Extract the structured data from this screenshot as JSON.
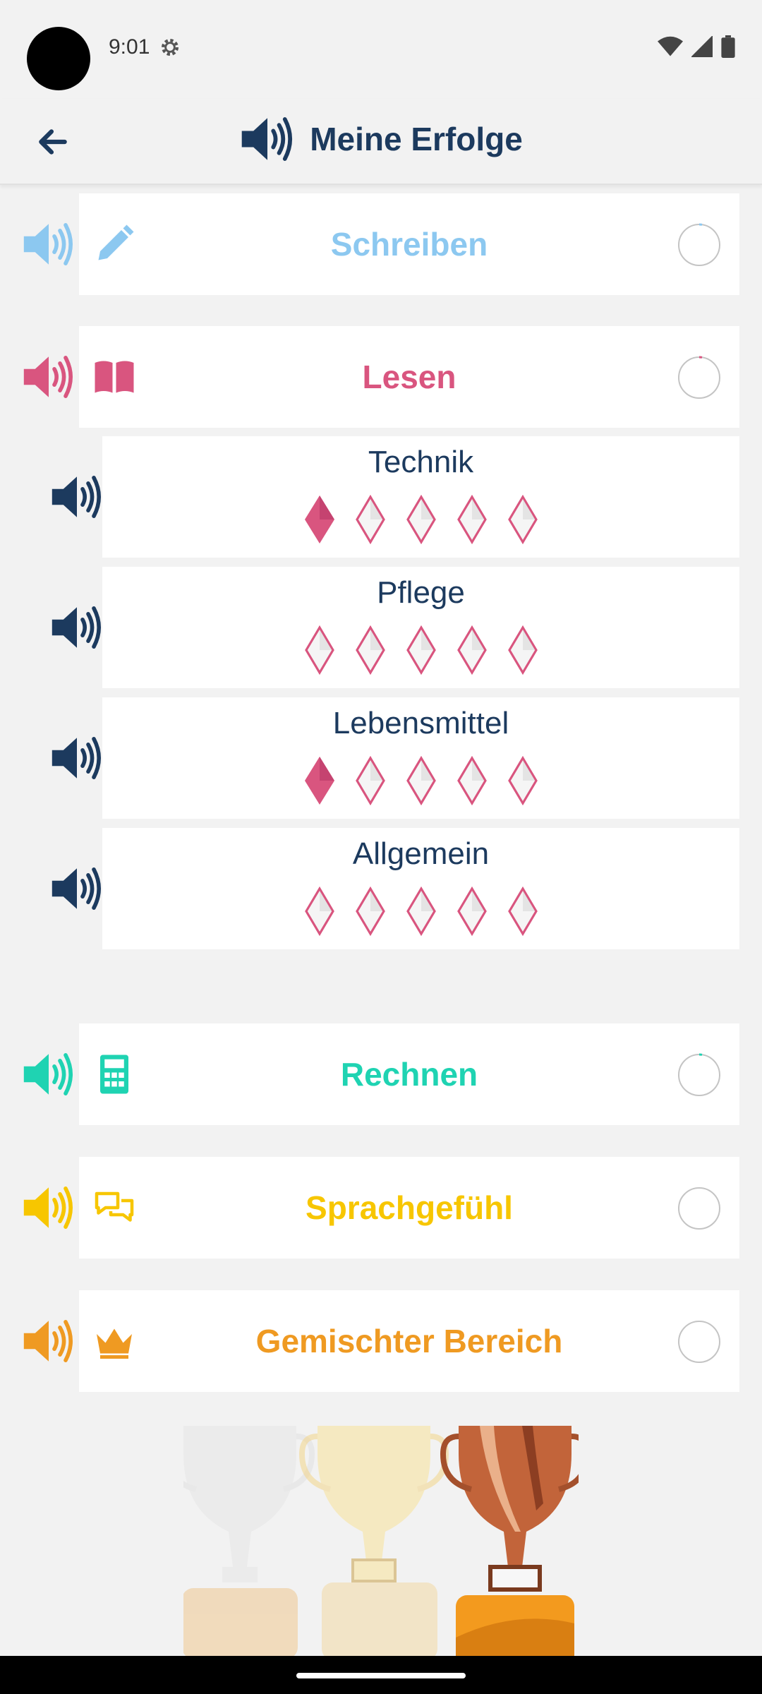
{
  "status": {
    "time": "9:01"
  },
  "header": {
    "title": "Meine Erfolge"
  },
  "colors": {
    "navy": "#1c3a5e",
    "schreiben": "#8cc8f0",
    "lesen": "#d9557f",
    "rechnen": "#1fd3b2",
    "sprachgefuehl": "#f7c600",
    "gemischt": "#ef9a22"
  },
  "categories": [
    {
      "label": "Schreiben",
      "icon": "pencil-icon",
      "color": "#8cc8f0",
      "progress": 0.02
    },
    {
      "label": "Lesen",
      "icon": "book-icon",
      "color": "#d9557f",
      "progress": 0.02
    },
    {
      "label": "Rechnen",
      "icon": "calculator-icon",
      "color": "#1fd3b2",
      "progress": 0.02
    },
    {
      "label": "Sprachgefühl",
      "icon": "chat-icon",
      "color": "#f7c600",
      "progress": 0
    },
    {
      "label": "Gemischter Bereich",
      "icon": "crown-icon",
      "color": "#ef9a22",
      "progress": 0
    }
  ],
  "lesen_topics": [
    {
      "name": "Technik",
      "achieved": 1,
      "total": 5
    },
    {
      "name": "Pflege",
      "achieved": 0,
      "total": 5
    },
    {
      "name": "Lebensmittel",
      "achieved": 1,
      "total": 5
    },
    {
      "name": "Allgemein",
      "achieved": 0,
      "total": 5
    }
  ]
}
